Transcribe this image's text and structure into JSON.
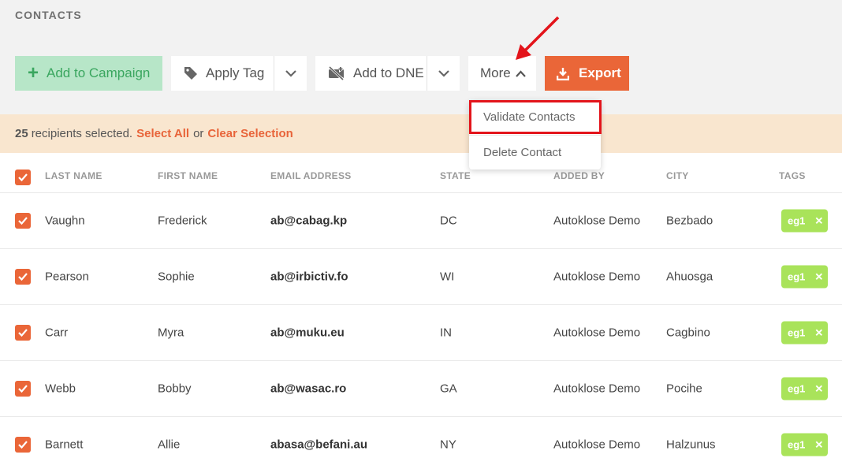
{
  "page": {
    "title": "CONTACTS"
  },
  "toolbar": {
    "add_campaign": "Add to Campaign",
    "apply_tag": "Apply Tag",
    "add_dne": "Add to DNE",
    "more": "More",
    "export": "Export"
  },
  "selection": {
    "count": "25",
    "text": "recipients selected.",
    "select_all": "Select All",
    "or": "or",
    "clear": "Clear Selection"
  },
  "dropdown": {
    "items": [
      "Validate Contacts",
      "Delete Contact"
    ]
  },
  "columns": [
    "LAST NAME",
    "FIRST NAME",
    "EMAIL ADDRESS",
    "STATE",
    "ADDED BY",
    "CITY",
    "TAGS"
  ],
  "rows": [
    {
      "last": "Vaughn",
      "first": "Frederick",
      "email": "ab@cabag.kp",
      "state": "DC",
      "added_by": "Autoklose Demo",
      "city": "Bezbado",
      "tag": "eg1"
    },
    {
      "last": "Pearson",
      "first": "Sophie",
      "email": "ab@irbictiv.fo",
      "state": "WI",
      "added_by": "Autoklose Demo",
      "city": "Ahuosga",
      "tag": "eg1"
    },
    {
      "last": "Carr",
      "first": "Myra",
      "email": "ab@muku.eu",
      "state": "IN",
      "added_by": "Autoklose Demo",
      "city": "Cagbino",
      "tag": "eg1"
    },
    {
      "last": "Webb",
      "first": "Bobby",
      "email": "ab@wasac.ro",
      "state": "GA",
      "added_by": "Autoklose Demo",
      "city": "Pocihe",
      "tag": "eg1"
    },
    {
      "last": "Barnett",
      "first": "Allie",
      "email": "abasa@befani.au",
      "state": "NY",
      "added_by": "Autoklose Demo",
      "city": "Halzunus",
      "tag": "eg1"
    }
  ],
  "colors": {
    "accent": "#ea6638",
    "campaign_bg": "#b7e6c8",
    "campaign_text": "#3aa65f",
    "tag_bg": "#a9e35a",
    "selection_bg": "#f9e6cf",
    "highlight": "#e3141b"
  }
}
